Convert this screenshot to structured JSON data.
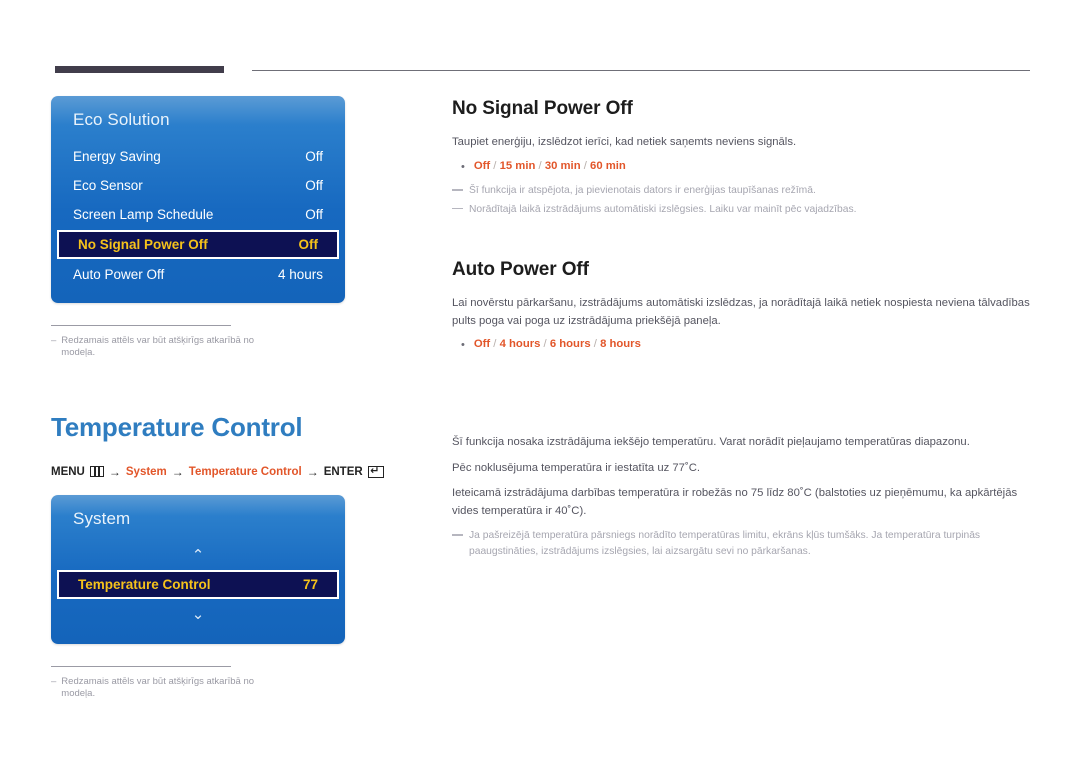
{
  "page": {
    "language_note": "Latvian UI manual page"
  },
  "sections": [
    {
      "id": "no-signal-power-off",
      "title": "No Signal Power Off",
      "paragraphs": [
        "Taupiet enerģiju, izslēdzot ierīci, kad netiek saņemts neviens signāls."
      ],
      "options": [
        "Off",
        "15 min",
        "30 min",
        "60 min"
      ],
      "notes": [
        "Šī funkcija ir atspējota, ja pievienotais dators ir enerģijas taupīšanas režīmā.",
        "Norādītajā laikā izstrādājums automātiski izslēgsies. Laiku var mainīt pēc vajadzības."
      ]
    },
    {
      "id": "auto-power-off",
      "title": "Auto Power Off",
      "paragraphs": [
        "Lai novērstu pārkaršanu, izstrādājums automātiski izslēdzas, ja norādītajā laikā netiek nospiesta neviena tālvadības pults poga vai poga uz izstrādājuma priekšējā paneļa."
      ],
      "options": [
        "Off",
        "4 hours",
        "6 hours",
        "8 hours"
      ],
      "notes": []
    },
    {
      "id": "temperature-control-body",
      "title": "",
      "paragraphs": [
        "Šī funkcija nosaka izstrādājuma iekšējo temperatūru. Varat norādīt pieļaujamo temperatūras diapazonu.",
        "Pēc noklusējuma temperatūra ir iestatīta uz 77˚C.",
        "Ieteicamā izstrādājuma darbības temperatūra ir robežās no 75 līdz 80˚C (balstoties uz pieņēmumu, ka apkārtējās vides temperatūra ir 40˚C)."
      ],
      "options": [],
      "notes": [
        "Ja pašreizējā temperatūra pārsniegs norādīto temperatūras limitu, ekrāns kļūs tumšāks. Ja temperatūra turpinās paaugstināties, izstrādājums izslēgsies, lai aizsargātu sevi no pārkaršanas."
      ]
    }
  ],
  "osd_eco": {
    "title": "Eco Solution",
    "rows": [
      {
        "label": "Energy Saving",
        "value": "Off",
        "selected": false
      },
      {
        "label": "Eco Sensor",
        "value": "Off",
        "selected": false
      },
      {
        "label": "Screen Lamp Schedule",
        "value": "Off",
        "selected": false
      },
      {
        "label": "No Signal Power Off",
        "value": "Off",
        "selected": true
      },
      {
        "label": "Auto Power Off",
        "value": "4 hours",
        "selected": false
      }
    ]
  },
  "osd_system": {
    "title": "System",
    "chevron_up": "⌃",
    "chevron_down": "⌄",
    "rows": [
      {
        "label": "Temperature Control",
        "value": "77",
        "selected": true
      }
    ]
  },
  "left_heading": {
    "title": "Temperature Control"
  },
  "menu_path": {
    "menu_label": "MENU",
    "menu_icon": "menu-grid-icon",
    "arrow": "→",
    "step1": "System",
    "step2": "Temperature Control",
    "enter_label": "ENTER",
    "enter_icon": "enter-return-icon"
  },
  "footnotes": {
    "dash": "–",
    "text": "Redzamais attēls var būt atšķirīgs atkarībā no modeļa."
  },
  "colors": {
    "accent_blue": "#2f7dc0",
    "accent_orange": "#e2562a",
    "osd_blue": "#1769c0",
    "osd_selected_bg": "#0d1153",
    "osd_selected_text": "#f5c21b",
    "top_rule_dark": "#413d4b"
  }
}
